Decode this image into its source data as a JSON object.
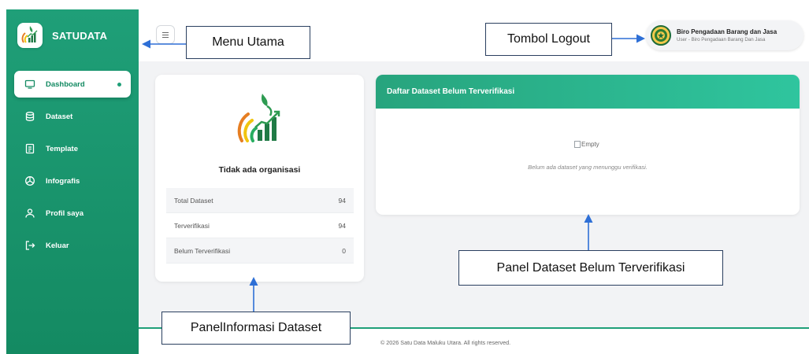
{
  "brand": {
    "name": "SATUDATA"
  },
  "sidebar": {
    "items": [
      {
        "label": "Dashboard",
        "icon": "monitor-icon",
        "active": true
      },
      {
        "label": "Dataset",
        "icon": "database-icon"
      },
      {
        "label": "Template",
        "icon": "document-icon"
      },
      {
        "label": "Infografis",
        "icon": "pie-chart-icon"
      },
      {
        "label": "Profil saya",
        "icon": "user-icon"
      },
      {
        "label": "Keluar",
        "icon": "logout-icon"
      }
    ]
  },
  "topbar": {
    "menu_icon": "hamburger-icon",
    "user": {
      "name": "Biro Pengadaan Barang dan Jasa",
      "role": "User - Biro Pengadaan Barang Dan Jasa"
    }
  },
  "org_panel": {
    "title": "Tidak ada organisasi",
    "stats": [
      {
        "label": "Total Dataset",
        "value": "94"
      },
      {
        "label": "Terverifikasi",
        "value": "94"
      },
      {
        "label": "Belum Terverifikasi",
        "value": "0"
      }
    ]
  },
  "pending_panel": {
    "title": "Daftar Dataset Belum Terverifikasi",
    "empty_alt": "Empty",
    "empty_message": "Belum ada dataset yang menunggu verifikasi."
  },
  "footer": {
    "text": "© 2026 Satu Data Maluku Utara. All rights reserved."
  },
  "annotations": {
    "menu_utama": "Menu Utama",
    "tombol_logout": "Tombol Logout",
    "panel_informasi": "PanelInformasi Dataset",
    "panel_dataset": "Panel Dataset Belum Terverifikasi"
  },
  "colors": {
    "primary": "#1f9f78",
    "header_gradient_end": "#2fc59e",
    "annotation_arrow": "#2e6fd6"
  }
}
